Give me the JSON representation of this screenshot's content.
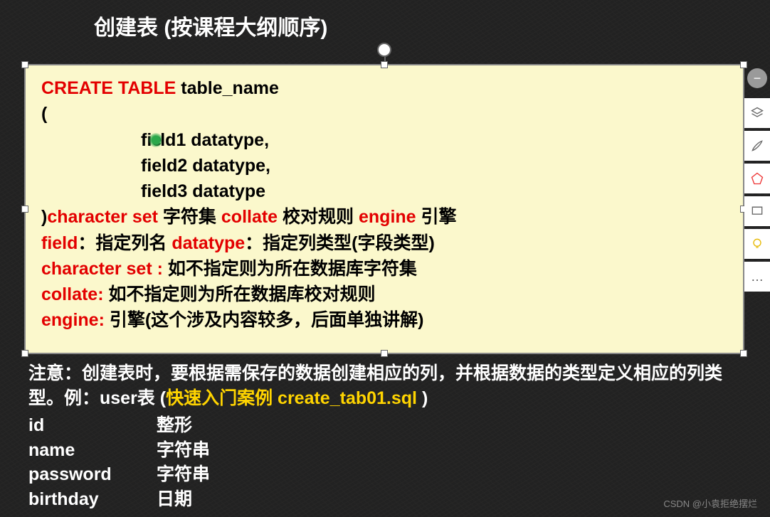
{
  "title": "创建表 (按课程大纲顺序)",
  "code": {
    "l1_red": "CREATE TABLE",
    "l1_blk": " table_name",
    "l2": "(",
    "f1a": "fie",
    "f1b": "ld1",
    "f1c": "  datatype,",
    "f2": "field2  datatype,",
    "f3": "field3  datatype",
    "l6a": ")",
    "l6b": "character set",
    "l6c": " 字符集   ",
    "l6d": "collate",
    "l6e": " 校对规则 ",
    "l6f": "engine",
    "l6g": " 引擎",
    "l7a": "field",
    "l7b": "：指定列名   ",
    "l7c": "datatype",
    "l7d": "：指定列类型(字段类型)",
    "l8a": "character set :",
    "l8b": " 如不指定则为所在数据库字符集",
    "l9a": "collate:",
    "l9b": " 如不指定则为所在数据库校对规则",
    "l10a": "engine:",
    "l10b": " 引擎(这个涉及内容较多，后面单独讲解)"
  },
  "notes": {
    "p1a": "注意：创建表时，要根据需保存的数据创建相应的列，并根据数据的类型定义相应的列类型。例：user表 (",
    "p1b": "快速入门案例 create_tab01.sql ",
    "p1c": ")",
    "rows": [
      {
        "c1": "id",
        "c2": "整形"
      },
      {
        "c1": "name",
        "c2": "字符串"
      },
      {
        "c1": "password",
        "c2": "字符串"
      },
      {
        "c1": "birthday",
        "c2": "日期"
      }
    ]
  },
  "sidebar": {
    "minus": "−",
    "layers": "layers-icon",
    "brush": "brush-icon",
    "pentagon": "pentagon-icon",
    "present": "present-icon",
    "bulb": "bulb-icon",
    "more": "…"
  },
  "watermark": "CSDN @小袁拒绝摆烂"
}
